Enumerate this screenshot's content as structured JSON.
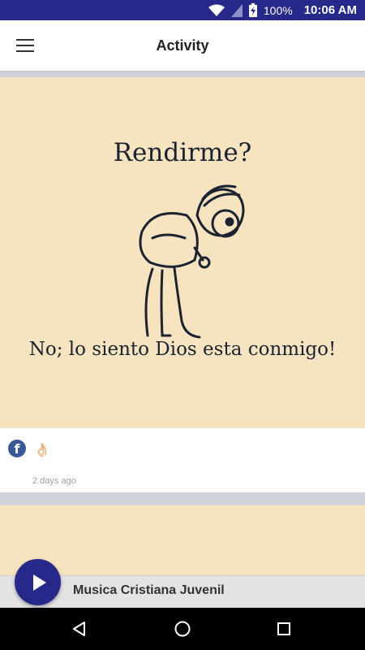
{
  "status_bar": {
    "battery_text": "100%",
    "time": "10:06 AM"
  },
  "app_bar": {
    "title": "Activity"
  },
  "post": {
    "image_text_top": "Rendirme?",
    "image_text_bottom": "No; lo siento Dios esta conmigo!",
    "source_icon": "facebook-icon",
    "emoji": "👌🏻",
    "timestamp": "2 days ago"
  },
  "player": {
    "station_name": "Musica Cristiana Juvenil",
    "accent_color": "#26288a"
  },
  "navigation": {
    "icons": [
      "back-icon",
      "home-icon",
      "recents-icon"
    ]
  }
}
